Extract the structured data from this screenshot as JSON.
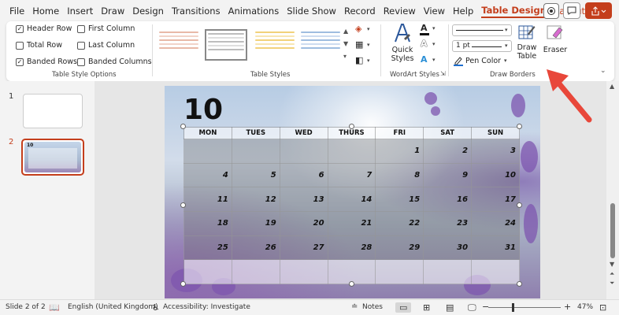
{
  "menu": {
    "tabs": [
      "File",
      "Home",
      "Insert",
      "Draw",
      "Design",
      "Transitions",
      "Animations",
      "Slide Show",
      "Record",
      "Review",
      "View",
      "Help",
      "Table Design",
      "Layout"
    ],
    "active_tab": "Table Design"
  },
  "ribbon": {
    "table_style_options": {
      "label": "Table Style Options",
      "options": [
        {
          "label": "Header Row",
          "checked": true
        },
        {
          "label": "Total Row",
          "checked": false
        },
        {
          "label": "Banded Rows",
          "checked": true
        },
        {
          "label": "First Column",
          "checked": false
        },
        {
          "label": "Last Column",
          "checked": false
        },
        {
          "label": "Banded Columns",
          "checked": false
        }
      ]
    },
    "table_styles": {
      "label": "Table Styles"
    },
    "wordart_styles": {
      "label": "WordArt Styles",
      "quick_styles": "Quick Styles"
    },
    "draw_borders": {
      "label": "Draw Borders",
      "pen_weight": "1 pt",
      "pen_color": "Pen Color",
      "draw_table": "Draw Table",
      "eraser": "Eraser"
    }
  },
  "slides": {
    "numbers": [
      "1",
      "2"
    ],
    "active": "2"
  },
  "slide": {
    "month_number": "10",
    "table": {
      "headers": [
        "MON",
        "TUES",
        "WED",
        "THURS",
        "FRI",
        "SAT",
        "SUN"
      ],
      "rows": [
        [
          "",
          "",
          "",
          "",
          "1",
          "2",
          "3"
        ],
        [
          "4",
          "5",
          "6",
          "7",
          "8",
          "9",
          "10"
        ],
        [
          "11",
          "12",
          "13",
          "14",
          "15",
          "16",
          "17"
        ],
        [
          "18",
          "19",
          "20",
          "21",
          "22",
          "23",
          "24"
        ],
        [
          "25",
          "26",
          "27",
          "28",
          "29",
          "30",
          "31"
        ],
        [
          "",
          "",
          "",
          "",
          "",
          "",
          ""
        ]
      ]
    }
  },
  "status": {
    "slide_counter": "Slide 2 of 2",
    "language": "English (United Kingdom)",
    "accessibility": "Accessibility: Investigate",
    "notes": "Notes",
    "zoom": "47%"
  },
  "colors": {
    "accent": "#c43e1c",
    "annotation_arrow": "#e8473a"
  }
}
